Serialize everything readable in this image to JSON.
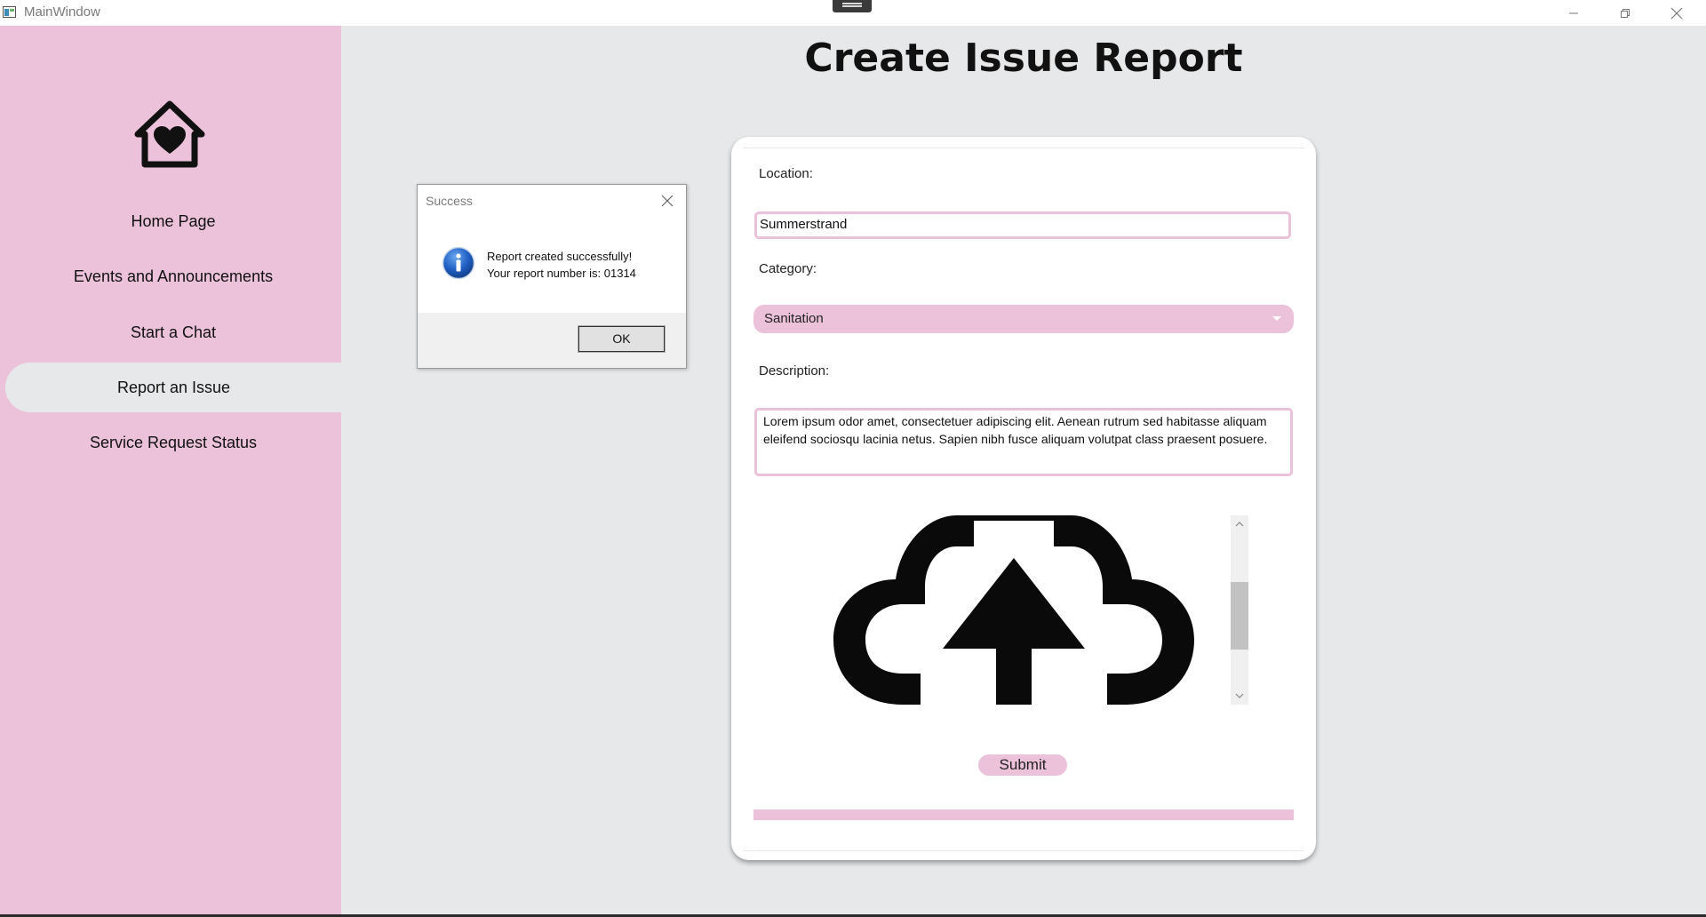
{
  "window": {
    "title": "MainWindow"
  },
  "sidebar": {
    "logo_icon": "home-heart-icon",
    "items": [
      {
        "label": "Home Page",
        "active": false
      },
      {
        "label": "Events and Announcements",
        "active": false
      },
      {
        "label": "Start a Chat",
        "active": false
      },
      {
        "label": "Report an Issue",
        "active": true
      },
      {
        "label": "Service Request Status",
        "active": false
      }
    ]
  },
  "page": {
    "title": "Create Issue Report"
  },
  "form": {
    "location_label": "Location:",
    "location_value": "Summerstrand",
    "category_label": "Category:",
    "category_value": "Sanitation",
    "description_label": "Description:",
    "description_value": "Lorem ipsum odor amet, consectetuer adipiscing elit. Aenean rutrum sed habitasse aliquam eleifend sociosqu lacinia netus. Sapien nibh fusce aliquam volutpat class praesent posuere.",
    "upload_icon": "cloud-upload-icon",
    "submit_label": "Submit"
  },
  "dialog": {
    "title": "Success",
    "icon": "info-icon",
    "message_line1": "Report created successfully!",
    "message_line2": "Your report number is: 01314",
    "ok_label": "OK"
  },
  "colors": {
    "accent_pink": "#ebc2da",
    "background": "#e7e8ea",
    "card": "#ffffff"
  }
}
